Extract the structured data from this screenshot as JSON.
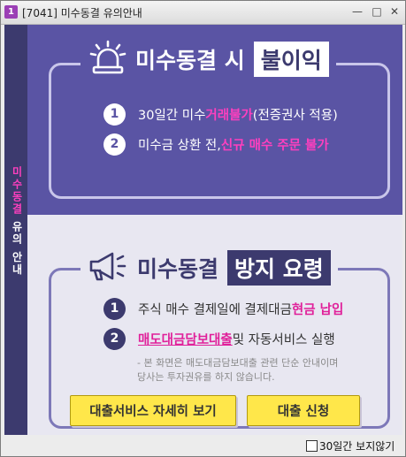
{
  "window": {
    "icon_label": "1",
    "title": "[7041] 미수동결 유의안내",
    "minimize_glyph": "—",
    "maximize_glyph": "□",
    "close_glyph": "✕"
  },
  "sidebar": {
    "label_highlight": "미수동결",
    "label_rest": " 유의 안내"
  },
  "section1": {
    "icon": "siren-icon",
    "title_normal": "미수동결 시",
    "title_highlight": "불이익",
    "items": [
      {
        "number": "1",
        "text_before": "30일간 미수",
        "text_highlight": "거래불가",
        "text_after": " (전증권사 적용)"
      },
      {
        "number": "2",
        "text_before": "미수금 상환 전, ",
        "text_highlight": "신규 매수 주문 불가"
      }
    ]
  },
  "section2": {
    "icon": "megaphone-icon",
    "title_normal": "미수동결",
    "title_highlight": "방지 요령",
    "items": [
      {
        "number": "1",
        "text_before": "주식 매수 결제일에 결제대금 ",
        "text_highlight": "현금 납입"
      },
      {
        "number": "2",
        "text_link": "매도대금담보대출",
        "text_after": " 및 자동서비스 실행"
      }
    ],
    "disclaimer_line1": "- 본 화면은 매도대금담보대출 관련 단순 안내이며",
    "disclaimer_line2": "당사는 투자권유를 하지 않습니다.",
    "buttons": {
      "details_label": "대출서비스 자세히 보기",
      "apply_label": "대출 신청"
    }
  },
  "footer": {
    "checkbox_label": "30일간  보지않기",
    "checked": false
  },
  "colors": {
    "upper_bg": "#5a54a4",
    "sidebar_bg": "#3c3a6e",
    "lower_bg": "#e8e7f1",
    "accent_pink": "#ff3fbf",
    "button_yellow": "#ffe74a"
  }
}
